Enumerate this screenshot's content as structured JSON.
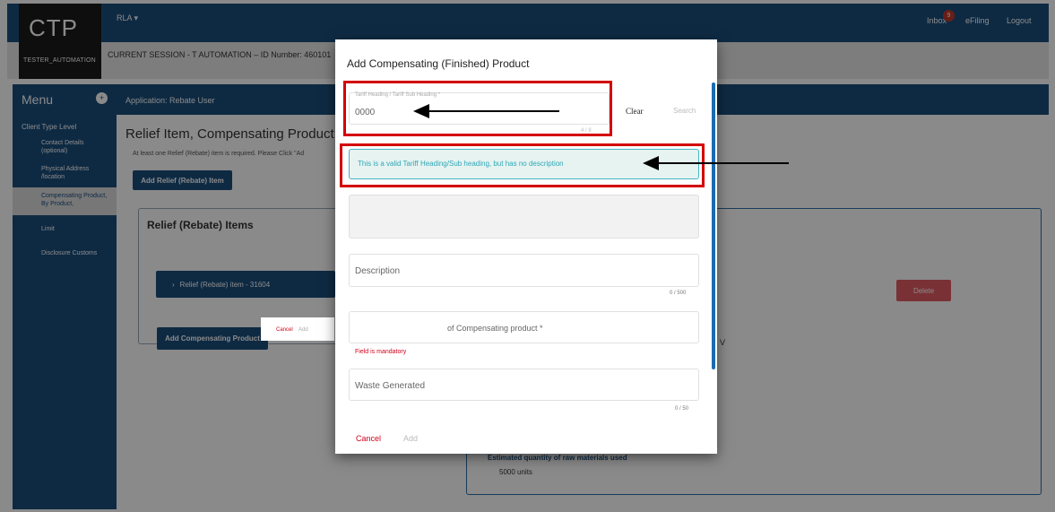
{
  "header": {
    "logo": "CTP",
    "user": "TESTER_AUTOMATION",
    "rla_menu": "RLA",
    "inbox_label": "Inbox",
    "inbox_count": "9",
    "efiling": "eFiling",
    "logout": "Logout",
    "session": "CURRENT SESSION - T AUTOMATION – ID Number: 460101"
  },
  "sidebar": {
    "title": "Menu",
    "section": "Client Type Level",
    "items": [
      {
        "label": "Contact Details (optional)"
      },
      {
        "label": "Physical Address /location"
      },
      {
        "label": "Compensating Product, By Product,"
      },
      {
        "label": "Limit"
      },
      {
        "label": "Disclosure Customs"
      }
    ]
  },
  "main": {
    "appbar": "Application: Rebate User",
    "title": "Relief Item, Compensating Product, B",
    "note": "At least one Relief (Rebate) item is required. Please Click \"Ad",
    "add_relief_button": "Add Relief (Rebate) Item",
    "relief_panel_title": "Relief (Rebate) Items",
    "relief_item": "Relief (Rebate) item - 31604",
    "add_compensating_button": "Add Compensating Product",
    "delete_button": "Delete",
    "v_letter": "V",
    "estimated_label": "Estimated quantity of raw materials used",
    "estimated_value": "5000 units",
    "mini_cancel": "Cancel",
    "mini_add": "Add"
  },
  "modal": {
    "title": "Add Compensating (Finished) Product",
    "tariff_label": "Tariff Heading / Tariff Sub Heading *",
    "tariff_value": "0000",
    "tariff_counter": "4 / 8",
    "clear": "Clear",
    "search": "Search",
    "valid_message": "This is a valid Tariff Heading/Sub heading, but has no description",
    "description_placeholder": "Description",
    "description_counter": "0 / 500",
    "type_placeholder": "of Compensating product *",
    "mandatory": "Field is mandatory",
    "waste_placeholder": "Waste Generated",
    "waste_counter": "0 / 50",
    "cancel": "Cancel",
    "add": "Add"
  },
  "colors": {
    "primary": "#1b4e7d",
    "highlight": "#d40000",
    "valid": "#2fa7b6",
    "error": "#d0021b",
    "delete": "#e25b62"
  },
  "icons": {
    "menu_toggle": "plus-circle-icon",
    "rla_dropdown": "caret-down-icon",
    "relief_expand": "chevron-right-icon"
  }
}
